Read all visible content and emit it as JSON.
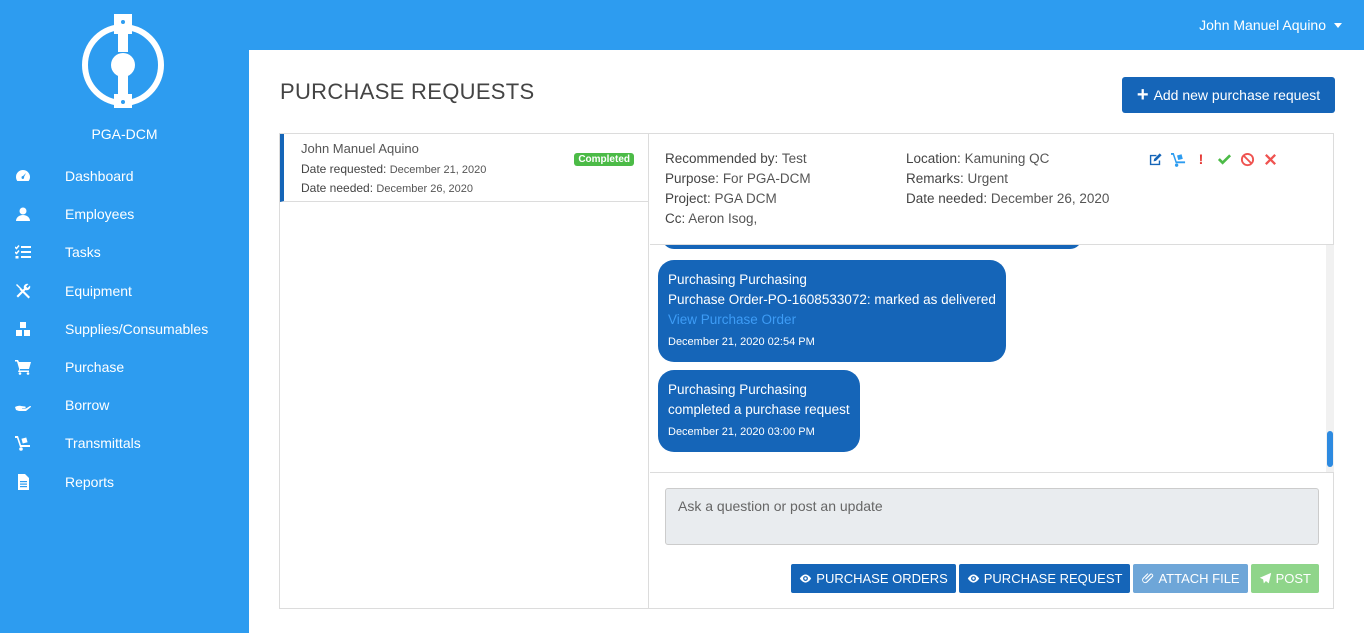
{
  "user": {
    "name": "John Manuel Aquino"
  },
  "brand": {
    "name": "PGA-DCM"
  },
  "sidebar": {
    "items": [
      {
        "label": "Dashboard",
        "icon": "dashboard-icon"
      },
      {
        "label": "Employees",
        "icon": "user-icon"
      },
      {
        "label": "Tasks",
        "icon": "tasks-icon"
      },
      {
        "label": "Equipment",
        "icon": "tools-icon"
      },
      {
        "label": "Supplies/Consumables",
        "icon": "boxes-icon"
      },
      {
        "label": "Purchase",
        "icon": "cart-icon"
      },
      {
        "label": "Borrow",
        "icon": "hand-icon"
      },
      {
        "label": "Transmittals",
        "icon": "dolly-icon"
      },
      {
        "label": "Reports",
        "icon": "file-icon"
      }
    ]
  },
  "page": {
    "title": "PURCHASE REQUESTS",
    "add_label": "Add new purchase request"
  },
  "request": {
    "name": "John Manuel Aquino",
    "date_requested_label": "Date requested:",
    "date_requested": "December 21, 2020",
    "date_needed_label": "Date needed:",
    "date_needed": "December 26, 2020",
    "status": "Completed"
  },
  "detail": {
    "recommended_by_label": "Recommended by:",
    "recommended_by": "Test",
    "purpose_label": "Purpose:",
    "purpose": "For PGA-DCM",
    "project_label": "Project:",
    "project": "PGA DCM",
    "cc_label": "Cc:",
    "cc": "Aeron Isog,",
    "location_label": "Location:",
    "location": "Kamuning QC",
    "remarks_label": "Remarks:",
    "remarks": "Urgent",
    "date_needed_label": "Date needed:",
    "date_needed": "December 26, 2020"
  },
  "messages": [
    {
      "author": "Purchasing Purchasing",
      "text": "Purchase Order-PO-1608533072: marked as delivered",
      "link": "View Purchase Order",
      "time": "December 21, 2020 02:54 PM"
    },
    {
      "author": "Purchasing Purchasing",
      "text": "completed a purchase request",
      "time": "December 21, 2020 03:00 PM"
    }
  ],
  "compose": {
    "placeholder": "Ask a question or post an update"
  },
  "buttons": {
    "purchase_orders": "PURCHASE ORDERS",
    "purchase_request": "PURCHASE REQUEST",
    "attach_file": "ATTACH FILE",
    "post": "POST"
  },
  "colors": {
    "primary": "#2d9cf0",
    "dark_blue": "#1565b8",
    "success": "#4cbb47"
  }
}
